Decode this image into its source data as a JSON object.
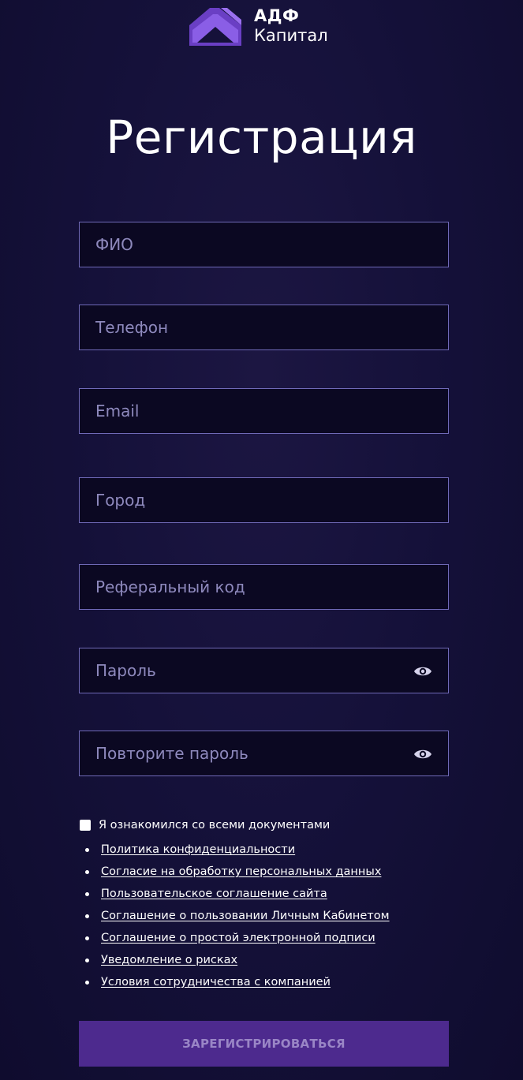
{
  "brand": {
    "line1": "АДФ",
    "line2": "Капитал",
    "accent_color": "#7b4fd4"
  },
  "title": "Регистрация",
  "fields": {
    "fio": {
      "placeholder": "ФИО",
      "value": ""
    },
    "phone": {
      "placeholder": "Телефон",
      "value": ""
    },
    "email": {
      "placeholder": "Email",
      "value": ""
    },
    "city": {
      "placeholder": "Город",
      "value": ""
    },
    "referral": {
      "placeholder": "Реферальный код",
      "value": ""
    },
    "password": {
      "placeholder": "Пароль",
      "value": "",
      "icon": "eye-icon"
    },
    "password_repeat": {
      "placeholder": "Повторите пароль",
      "value": "",
      "icon": "eye-icon"
    }
  },
  "consent": {
    "checked": false,
    "label": "Я ознакомился со всеми документами"
  },
  "documents": [
    "Политика конфиденциальности",
    "Согласие на обработку персональных данных",
    "Пользовательское соглашение сайта",
    "Соглашение о пользовании Личным Кабинетом",
    "Соглашение о простой электронной подписи",
    "Уведомление о рисках",
    "Условия сотрудничества с компанией"
  ],
  "submit_label": "Зарегистрироваться",
  "colors": {
    "background": "#15113a",
    "field_border": "#6f69b7",
    "field_background": "#0b0822",
    "button": "#4d2a8e"
  }
}
